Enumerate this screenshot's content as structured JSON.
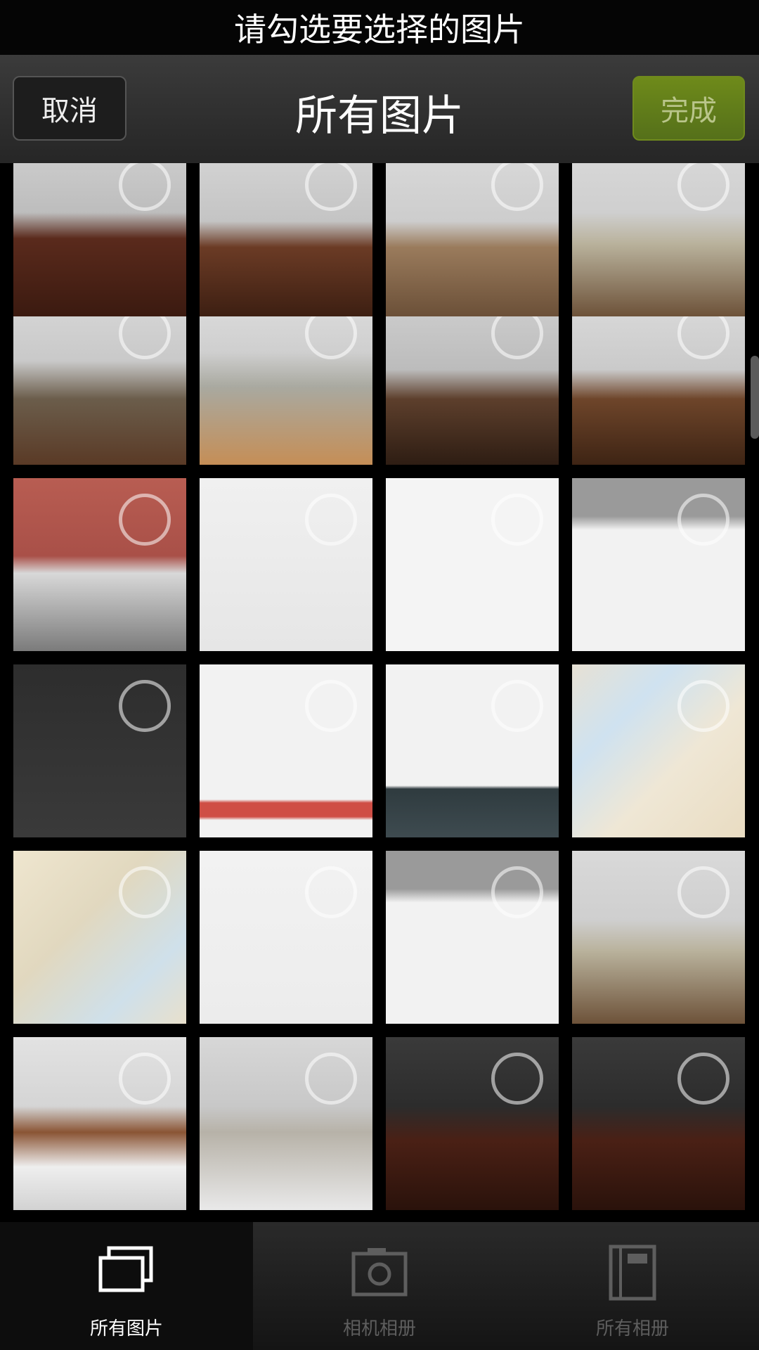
{
  "banner": "请勾选要选择的图片",
  "titlebar": {
    "cancel_label": "取消",
    "title": "所有图片",
    "done_label": "完成"
  },
  "tabs": [
    {
      "label": "所有图片",
      "icon": "stacked-photos-icon",
      "active": true
    },
    {
      "label": "相机相册",
      "icon": "camera-icon",
      "active": false
    },
    {
      "label": "所有相册",
      "icon": "album-icon",
      "active": false
    }
  ],
  "thumbnails": [
    {
      "kind": "room-floor",
      "name": "thumb-room-1"
    },
    {
      "kind": "room-dining",
      "name": "thumb-room-2"
    },
    {
      "kind": "room-bed-blanket",
      "name": "thumb-room-3"
    },
    {
      "kind": "room-bed",
      "name": "thumb-room-4"
    },
    {
      "kind": "room-sofa",
      "name": "thumb-sofa"
    },
    {
      "kind": "room-bed-tv",
      "name": "thumb-bed-tv"
    },
    {
      "kind": "room-window",
      "name": "thumb-room-window"
    },
    {
      "kind": "room-table",
      "name": "thumb-room-table"
    },
    {
      "kind": "building",
      "name": "thumb-building"
    },
    {
      "kind": "screenshot-app",
      "name": "thumb-screenshot-1"
    },
    {
      "kind": "screenshot-blank",
      "name": "thumb-screenshot-2"
    },
    {
      "kind": "screenshot-menu",
      "name": "thumb-screenshot-3"
    },
    {
      "kind": "phone-home",
      "name": "thumb-home-screen"
    },
    {
      "kind": "screenshot-form",
      "name": "thumb-screenshot-4"
    },
    {
      "kind": "screenshot-keyboard",
      "name": "thumb-screenshot-5"
    },
    {
      "kind": "map",
      "name": "thumb-map-1"
    },
    {
      "kind": "map-wide",
      "name": "thumb-map-2"
    },
    {
      "kind": "screenshot-pay",
      "name": "thumb-screenshot-6"
    },
    {
      "kind": "screenshot-menu",
      "name": "thumb-screenshot-7"
    },
    {
      "kind": "room-bed",
      "name": "thumb-room-5"
    },
    {
      "kind": "room-bed-white",
      "name": "thumb-room-6"
    },
    {
      "kind": "room-sofa-grey",
      "name": "thumb-room-7"
    },
    {
      "kind": "room-dark",
      "name": "thumb-room-8"
    },
    {
      "kind": "room-dark",
      "name": "thumb-room-9"
    }
  ]
}
